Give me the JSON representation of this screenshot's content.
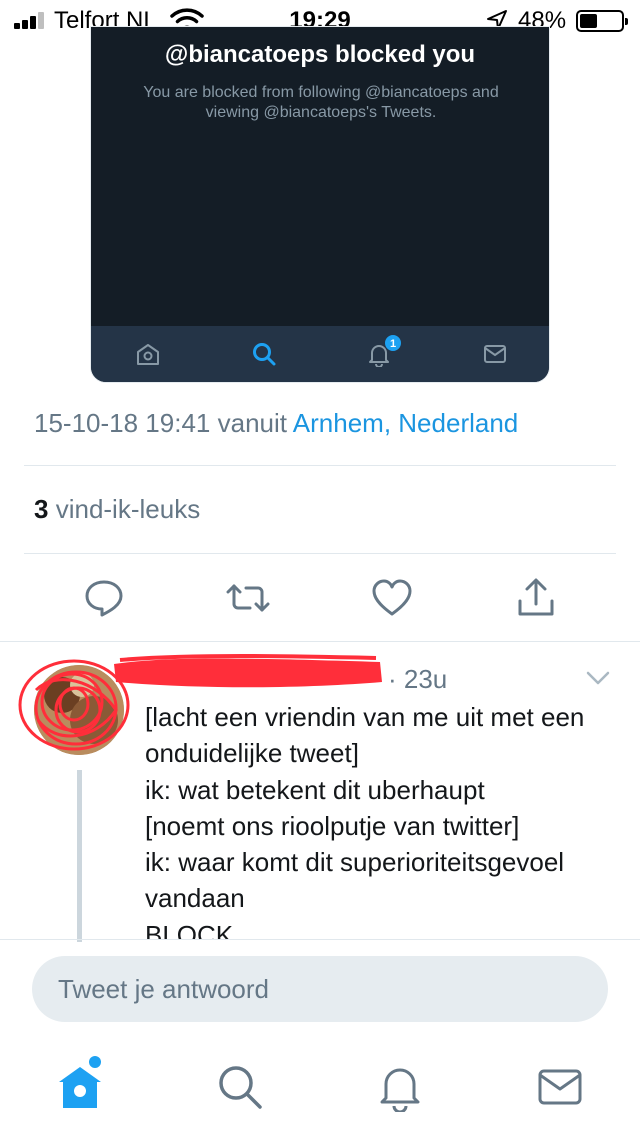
{
  "status_bar": {
    "carrier": "Telfort NL",
    "time": "19:29",
    "battery_percent": "48%",
    "battery_level": 0.48,
    "icons": [
      "signal-icon",
      "wifi-icon",
      "location-arrow-icon",
      "battery-icon"
    ]
  },
  "embedded_screenshot": {
    "title": "@biancatoeps blocked you",
    "description": "You are blocked from following @biancatoeps and viewing @biancatoeps's Tweets.",
    "tabs": [
      "home-icon",
      "search-icon",
      "bell-icon",
      "mail-icon"
    ],
    "notification_badge": "1"
  },
  "tweet_meta": {
    "datetime": "15-10-18 19:41",
    "via_word": "vanuit",
    "location": "Arnhem, Nederland"
  },
  "likes": {
    "count": "3",
    "label": "vind-ik-leuks"
  },
  "actions": [
    "reply-icon",
    "retweet-icon",
    "like-icon",
    "share-icon"
  ],
  "reply": {
    "time": "· 23u",
    "text": "[lacht een vriendin van me uit met een onduidelijke tweet]\nik: wat betekent dit uberhaupt\n[noemt ons rioolputje van twitter]\nik: waar komt dit superioriteitsgevoel vandaan\nBLOCK"
  },
  "composer": {
    "placeholder": "Tweet je antwoord"
  },
  "tab_bar": {
    "tabs": [
      "home-icon",
      "search-icon",
      "notifications-icon",
      "messages-icon"
    ]
  },
  "colors": {
    "accent": "#1da1f2",
    "link": "#1b95e0",
    "muted_text": "#657786",
    "dark_bg": "#141d26",
    "dark_tabbar": "#243447",
    "redaction": "#ff2e3a"
  }
}
